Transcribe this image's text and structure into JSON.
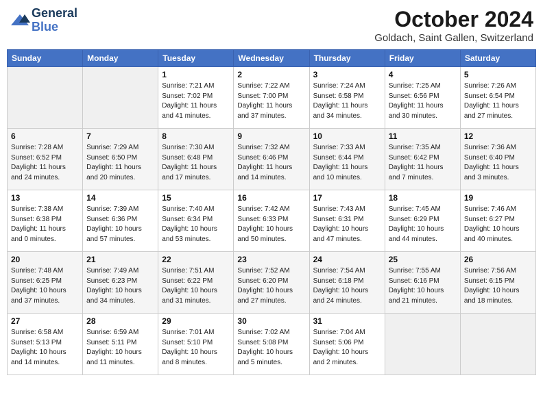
{
  "header": {
    "logo_line1": "General",
    "logo_line2": "Blue",
    "month": "October 2024",
    "location": "Goldach, Saint Gallen, Switzerland"
  },
  "weekdays": [
    "Sunday",
    "Monday",
    "Tuesday",
    "Wednesday",
    "Thursday",
    "Friday",
    "Saturday"
  ],
  "weeks": [
    [
      {
        "num": "",
        "info": ""
      },
      {
        "num": "",
        "info": ""
      },
      {
        "num": "1",
        "info": "Sunrise: 7:21 AM\nSunset: 7:02 PM\nDaylight: 11 hours and 41 minutes."
      },
      {
        "num": "2",
        "info": "Sunrise: 7:22 AM\nSunset: 7:00 PM\nDaylight: 11 hours and 37 minutes."
      },
      {
        "num": "3",
        "info": "Sunrise: 7:24 AM\nSunset: 6:58 PM\nDaylight: 11 hours and 34 minutes."
      },
      {
        "num": "4",
        "info": "Sunrise: 7:25 AM\nSunset: 6:56 PM\nDaylight: 11 hours and 30 minutes."
      },
      {
        "num": "5",
        "info": "Sunrise: 7:26 AM\nSunset: 6:54 PM\nDaylight: 11 hours and 27 minutes."
      }
    ],
    [
      {
        "num": "6",
        "info": "Sunrise: 7:28 AM\nSunset: 6:52 PM\nDaylight: 11 hours and 24 minutes."
      },
      {
        "num": "7",
        "info": "Sunrise: 7:29 AM\nSunset: 6:50 PM\nDaylight: 11 hours and 20 minutes."
      },
      {
        "num": "8",
        "info": "Sunrise: 7:30 AM\nSunset: 6:48 PM\nDaylight: 11 hours and 17 minutes."
      },
      {
        "num": "9",
        "info": "Sunrise: 7:32 AM\nSunset: 6:46 PM\nDaylight: 11 hours and 14 minutes."
      },
      {
        "num": "10",
        "info": "Sunrise: 7:33 AM\nSunset: 6:44 PM\nDaylight: 11 hours and 10 minutes."
      },
      {
        "num": "11",
        "info": "Sunrise: 7:35 AM\nSunset: 6:42 PM\nDaylight: 11 hours and 7 minutes."
      },
      {
        "num": "12",
        "info": "Sunrise: 7:36 AM\nSunset: 6:40 PM\nDaylight: 11 hours and 3 minutes."
      }
    ],
    [
      {
        "num": "13",
        "info": "Sunrise: 7:38 AM\nSunset: 6:38 PM\nDaylight: 11 hours and 0 minutes."
      },
      {
        "num": "14",
        "info": "Sunrise: 7:39 AM\nSunset: 6:36 PM\nDaylight: 10 hours and 57 minutes."
      },
      {
        "num": "15",
        "info": "Sunrise: 7:40 AM\nSunset: 6:34 PM\nDaylight: 10 hours and 53 minutes."
      },
      {
        "num": "16",
        "info": "Sunrise: 7:42 AM\nSunset: 6:33 PM\nDaylight: 10 hours and 50 minutes."
      },
      {
        "num": "17",
        "info": "Sunrise: 7:43 AM\nSunset: 6:31 PM\nDaylight: 10 hours and 47 minutes."
      },
      {
        "num": "18",
        "info": "Sunrise: 7:45 AM\nSunset: 6:29 PM\nDaylight: 10 hours and 44 minutes."
      },
      {
        "num": "19",
        "info": "Sunrise: 7:46 AM\nSunset: 6:27 PM\nDaylight: 10 hours and 40 minutes."
      }
    ],
    [
      {
        "num": "20",
        "info": "Sunrise: 7:48 AM\nSunset: 6:25 PM\nDaylight: 10 hours and 37 minutes."
      },
      {
        "num": "21",
        "info": "Sunrise: 7:49 AM\nSunset: 6:23 PM\nDaylight: 10 hours and 34 minutes."
      },
      {
        "num": "22",
        "info": "Sunrise: 7:51 AM\nSunset: 6:22 PM\nDaylight: 10 hours and 31 minutes."
      },
      {
        "num": "23",
        "info": "Sunrise: 7:52 AM\nSunset: 6:20 PM\nDaylight: 10 hours and 27 minutes."
      },
      {
        "num": "24",
        "info": "Sunrise: 7:54 AM\nSunset: 6:18 PM\nDaylight: 10 hours and 24 minutes."
      },
      {
        "num": "25",
        "info": "Sunrise: 7:55 AM\nSunset: 6:16 PM\nDaylight: 10 hours and 21 minutes."
      },
      {
        "num": "26",
        "info": "Sunrise: 7:56 AM\nSunset: 6:15 PM\nDaylight: 10 hours and 18 minutes."
      }
    ],
    [
      {
        "num": "27",
        "info": "Sunrise: 6:58 AM\nSunset: 5:13 PM\nDaylight: 10 hours and 14 minutes."
      },
      {
        "num": "28",
        "info": "Sunrise: 6:59 AM\nSunset: 5:11 PM\nDaylight: 10 hours and 11 minutes."
      },
      {
        "num": "29",
        "info": "Sunrise: 7:01 AM\nSunset: 5:10 PM\nDaylight: 10 hours and 8 minutes."
      },
      {
        "num": "30",
        "info": "Sunrise: 7:02 AM\nSunset: 5:08 PM\nDaylight: 10 hours and 5 minutes."
      },
      {
        "num": "31",
        "info": "Sunrise: 7:04 AM\nSunset: 5:06 PM\nDaylight: 10 hours and 2 minutes."
      },
      {
        "num": "",
        "info": ""
      },
      {
        "num": "",
        "info": ""
      }
    ]
  ]
}
